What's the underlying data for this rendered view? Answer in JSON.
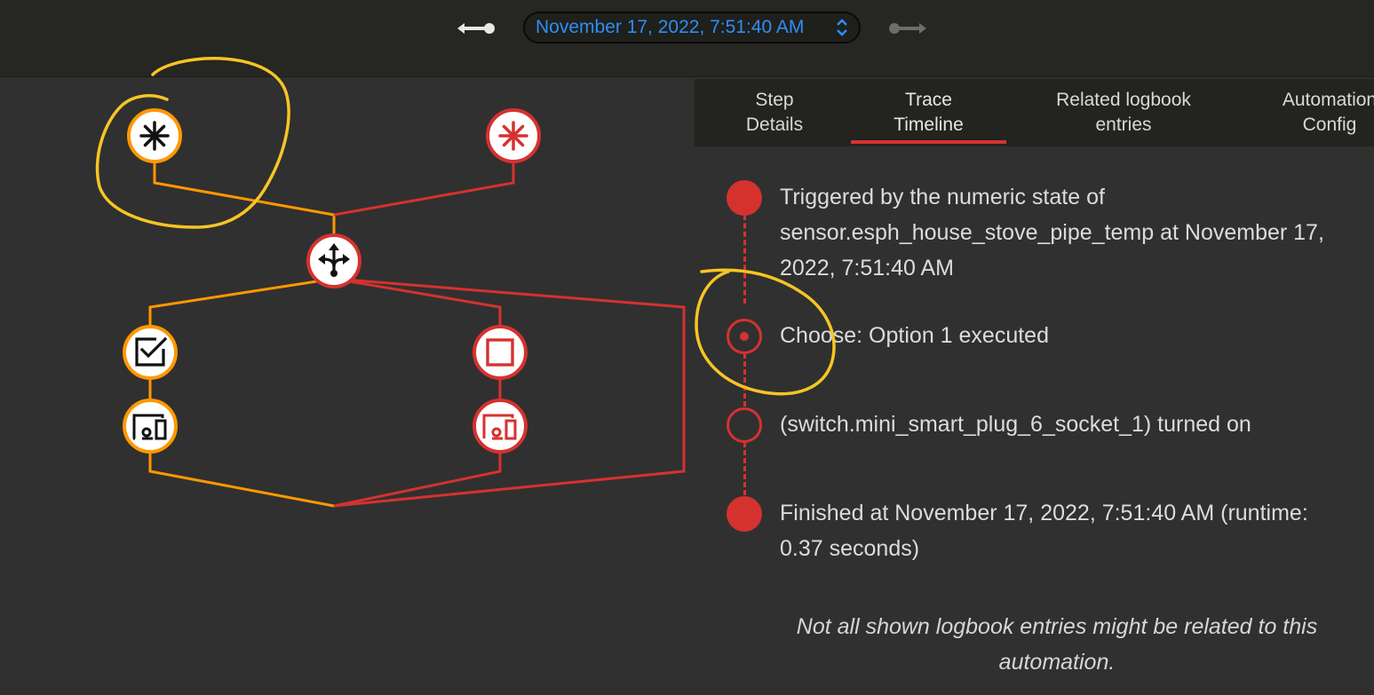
{
  "header": {
    "datetime": "November 17, 2022, 7:51:40 AM",
    "prev_icon": "arrow-left-icon",
    "next_icon": "arrow-right-icon"
  },
  "graph": {
    "nodes": [
      {
        "name": "trigger-node-1",
        "icon": "asterisk-icon",
        "color": "#ff9800"
      },
      {
        "name": "trigger-node-2",
        "icon": "asterisk-icon",
        "color": "#d5322f"
      },
      {
        "name": "choose-node",
        "icon": "call-split-icon",
        "color": "#d5322f"
      },
      {
        "name": "condition-node-checked",
        "icon": "checkbox-marked-icon",
        "color": "#ff9800"
      },
      {
        "name": "condition-node-unchecked",
        "icon": "checkbox-blank-icon",
        "color": "#d5322f"
      },
      {
        "name": "device-action-node-1",
        "icon": "devices-icon",
        "color": "#ff9800"
      },
      {
        "name": "device-action-node-2",
        "icon": "devices-icon",
        "color": "#d5322f"
      }
    ]
  },
  "tabs": [
    {
      "line1": "Step",
      "line2": "Details"
    },
    {
      "line1": "Trace",
      "line2": "Timeline",
      "active": true
    },
    {
      "line1": "Related logbook",
      "line2": "entries"
    },
    {
      "line1": "Automation",
      "line2": "Config"
    }
  ],
  "timeline": {
    "items": [
      {
        "lines": [
          "Triggered by the numeric state of",
          "sensor.esph_house_stove_pipe_temp at November 17,",
          "2022, 7:51:40 AM"
        ]
      },
      {
        "lines": [
          "Choose: Option 1 executed"
        ]
      },
      {
        "lines": [
          "(switch.mini_smart_plug_6_socket_1) turned on"
        ]
      },
      {
        "lines": [
          "Finished at November 17, 2022, 7:51:40 AM (runtime:",
          "0.37 seconds)"
        ]
      }
    ],
    "note_line1": "Not all shown logbook entries might be related to this",
    "note_line2": "automation."
  },
  "colors": {
    "active_path": "#ff9800",
    "inactive_path": "#d5322f",
    "annotation": "#f7c524",
    "accent_blue": "#2e8ef5"
  }
}
